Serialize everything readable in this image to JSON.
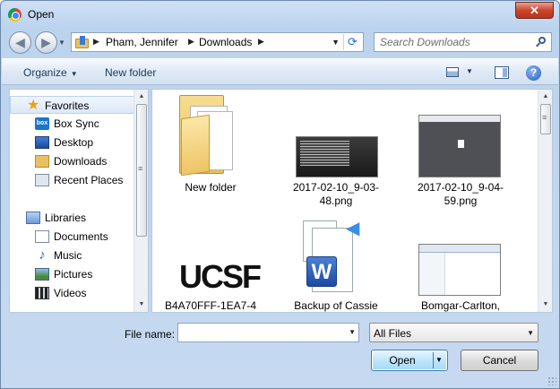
{
  "window": {
    "title": "Open",
    "close_label": "✕",
    "app_icon": "chrome-icon"
  },
  "address": {
    "crumbs": [
      "Pham, Jennifer",
      "Downloads"
    ],
    "separator": "▶",
    "refresh_glyph": "⟳"
  },
  "search": {
    "placeholder": "Search Downloads"
  },
  "toolbar": {
    "organize_label": "Organize",
    "new_folder_label": "New folder",
    "help_label": "?"
  },
  "nav": {
    "favorites_label": "Favorites",
    "favorites": [
      "Box Sync",
      "Desktop",
      "Downloads",
      "Recent Places"
    ],
    "libraries_label": "Libraries",
    "libraries": [
      "Documents",
      "Music",
      "Pictures",
      "Videos"
    ],
    "box_icon_text": "box"
  },
  "files": [
    {
      "name": "New folder",
      "kind": "folder"
    },
    {
      "name": "2017-02-10_9-03-48.png",
      "kind": "image-dark"
    },
    {
      "name": "2017-02-10_9-04-59.png",
      "kind": "image-gray"
    },
    {
      "name": "B4A70FFF-1EA7-4",
      "kind": "image-ucsf",
      "logo_text": "UCSF"
    },
    {
      "name": "Backup of Cassie",
      "kind": "word-backup",
      "logo_text": "W"
    },
    {
      "name": "Bomgar-Carlton,",
      "kind": "image-gray"
    }
  ],
  "bottom": {
    "file_name_label": "File name:",
    "file_name_value": "",
    "filter_value": "All Files",
    "open_label": "Open",
    "cancel_label": "Cancel"
  }
}
